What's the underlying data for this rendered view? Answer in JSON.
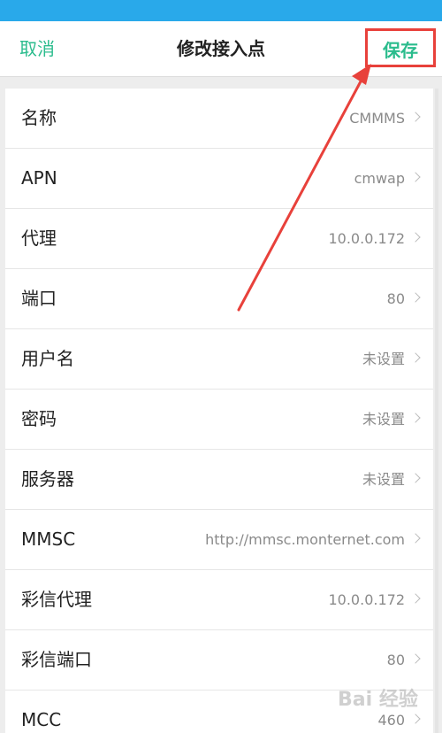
{
  "header": {
    "cancel_label": "取消",
    "title": "修改接入点",
    "save_label": "保存"
  },
  "rows": [
    {
      "label": "名称",
      "value": "CMMMS"
    },
    {
      "label": "APN",
      "value": "cmwap"
    },
    {
      "label": "代理",
      "value": "10.0.0.172"
    },
    {
      "label": "端口",
      "value": "80"
    },
    {
      "label": "用户名",
      "value": "未设置"
    },
    {
      "label": "密码",
      "value": "未设置"
    },
    {
      "label": "服务器",
      "value": "未设置"
    },
    {
      "label": "MMSC",
      "value": "http://mmsc.monternet.com"
    },
    {
      "label": "彩信代理",
      "value": "10.0.0.172"
    },
    {
      "label": "彩信端口",
      "value": "80"
    },
    {
      "label": "MCC",
      "value": "460"
    }
  ],
  "watermark": "Bai 经验",
  "colors": {
    "accent": "#2bbc8d",
    "status_bar": "#29a9ea",
    "highlight": "#e8413b"
  },
  "icons": [
    "chevron-right-icon",
    "annotation-arrow"
  ]
}
